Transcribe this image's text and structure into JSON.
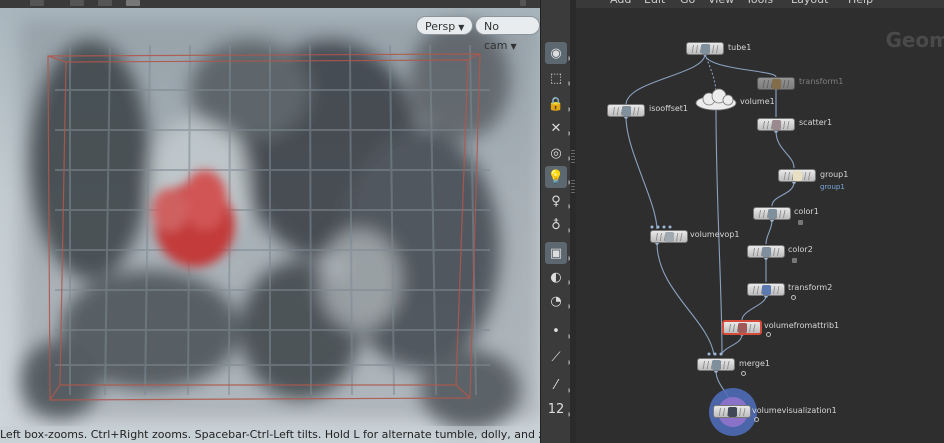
{
  "viewport": {
    "camera_view": "Persp",
    "camera_name": "No cam",
    "status_text": "Left box-zooms. Ctrl+Right zooms. Spacebar-Ctrl-Left tilts. Hold L for alternate tumble, dolly, and zoom."
  },
  "toolbar": {
    "tools": [
      {
        "name": "view-icon",
        "glyph": "◉",
        "active": true
      },
      {
        "name": "select-icon",
        "glyph": "⬚"
      },
      {
        "name": "lock-icon",
        "glyph": "🔒"
      },
      {
        "name": "snap-icon",
        "glyph": "✕"
      },
      {
        "name": "ghost-icon",
        "glyph": "◎"
      },
      {
        "name": "light-icon",
        "glyph": "💡",
        "active": true
      },
      {
        "name": "bulb-icon",
        "glyph": "♀"
      },
      {
        "name": "camera-rig-icon",
        "glyph": "♁"
      },
      {
        "name": "display-icon",
        "glyph": "▣",
        "active": true
      },
      {
        "name": "eye-icon",
        "glyph": "◐"
      },
      {
        "name": "render-icon",
        "glyph": "◔"
      },
      {
        "name": "point-icon",
        "glyph": "•"
      },
      {
        "name": "brush-icon",
        "glyph": "⟋"
      },
      {
        "name": "pen-icon",
        "glyph": "⁄"
      },
      {
        "name": "number-icon",
        "glyph": "12"
      }
    ]
  },
  "network": {
    "menu": [
      "Add",
      "Edit",
      "Go",
      "View",
      "Tools",
      "Layout",
      "Help"
    ],
    "context_title": "Geom",
    "nodes": {
      "tube1": "tube1",
      "transform1": "transform1",
      "volume1": "volume1",
      "isooffset1": "isooffset1",
      "scatter1": "scatter1",
      "group1": "group1",
      "group1_tag": "group1",
      "color1": "color1",
      "volumevop1": "volumevop1",
      "color2": "color2",
      "transform2": "transform2",
      "volumefromattrib1": "volumefromattrib1",
      "merge1": "merge1",
      "volumevisualization1": "volumevisualization1"
    }
  }
}
